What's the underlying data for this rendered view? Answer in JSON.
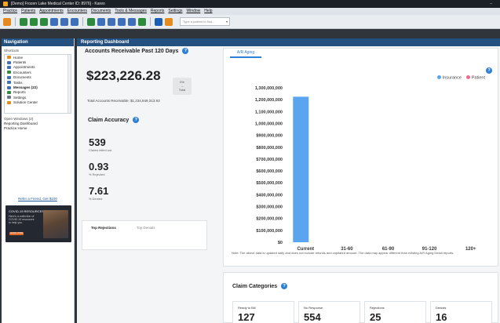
{
  "window": {
    "title": "[Demo] Frozen Lake Medical Center ID: 8976] - Kareo",
    "minimize": "–"
  },
  "menu": [
    "Practice",
    "Patients",
    "Appointments",
    "Encounters",
    "Documents",
    "Tools & Messages",
    "Reports",
    "Settings",
    "Window",
    "Help"
  ],
  "toolbar": {
    "icon_colors": [
      "#e58a1f",
      "#2e8b3e",
      "#2e8b3e",
      "#2e8b3e",
      "#3f6fb8",
      "#3f6fb8",
      "#3f6fb8",
      "#2e8b3e",
      "#3f6fb8",
      "#3f6fb8",
      "#3f6fb8",
      "#3f6fb8",
      "#2e8b3e",
      "#1a5fb4",
      "#e58a1f"
    ],
    "patient_search_placeholder": "Type a patient to find...",
    "dropdown_glyph": "▾"
  },
  "navigation": {
    "header": "Navigation",
    "shortcuts_label": "Shortcuts",
    "items": [
      {
        "label": "Home",
        "color": "#e58a1f",
        "active": false
      },
      {
        "label": "Patients",
        "color": "#3f6fb8",
        "active": false
      },
      {
        "label": "Appointments",
        "color": "#3f6fb8",
        "active": false
      },
      {
        "label": "Encounters",
        "color": "#2e8b3e",
        "active": false
      },
      {
        "label": "Documents",
        "color": "#3f6fb8",
        "active": false
      },
      {
        "label": "Tasks",
        "color": "#3f6fb8",
        "active": false
      },
      {
        "label": "Messages (22)",
        "color": "#3f6fb8",
        "active": true
      },
      {
        "label": "Reports",
        "color": "#2e8b3e",
        "active": false
      },
      {
        "label": "Settings",
        "color": "#6b7a8a",
        "active": false
      },
      {
        "label": "Solution Center",
        "color": "#e58a1f",
        "active": false
      }
    ],
    "open_windows_label": "Open Windows (2)",
    "open_windows": [
      "Reporting Dashboard",
      "Practice Home"
    ],
    "refer_link": "Refer a Friend, Get $100",
    "promo": {
      "title": "COVID-19 RESOURCES",
      "text": "Here's a collection of COVID-19 resources to help you.",
      "button": "LEARN MORE"
    }
  },
  "dashboard": {
    "header": "Reporting Dashboard",
    "ar": {
      "title": "Accounts Receivable Past 120 Days",
      "amount": "$223,226.28",
      "badge_pct": "0%",
      "badge_arrow": "→",
      "badge_label": "Total",
      "total_text": "Total Accounts Receivable: $1,234,849,313.93"
    },
    "accuracy": {
      "title": "Claim Accuracy",
      "stats": [
        {
          "value": "539",
          "label": "Claims billed out"
        },
        {
          "value": "0.93",
          "label": "% Rejected"
        },
        {
          "value": "7.61",
          "label": "% Denied"
        }
      ]
    },
    "rejections": {
      "tabs": [
        "Top Rejections",
        "Top Denials"
      ]
    },
    "aging": {
      "tab": "A/R Aging",
      "help_glyph": "?",
      "note": "Note: The above data is updated daily and does not include refunds and capitated amount. The data may appear different than existing A/R Aging Detail reports."
    },
    "categories": {
      "title": "Claim Categories",
      "boxes": [
        {
          "label": "Ready to Bill",
          "value": "127"
        },
        {
          "label": "No Response",
          "value": "554"
        },
        {
          "label": "Rejections",
          "value": "25"
        },
        {
          "label": "Denials",
          "value": "16"
        }
      ]
    }
  },
  "chart_data": {
    "type": "bar",
    "categories": [
      "Current",
      "31-60",
      "61-90",
      "91-120",
      "120+"
    ],
    "series": [
      {
        "name": "Insurance",
        "color": "#5ba4f0",
        "values": [
          1225000000,
          0,
          0,
          0,
          0
        ]
      },
      {
        "name": "Patient",
        "color": "#f06a8a",
        "values": [
          0,
          0,
          0,
          0,
          0
        ]
      }
    ],
    "xlabel": "Days",
    "ylim": [
      0,
      1300000000
    ],
    "yticks": [
      "$0",
      "$100,000,000",
      "$200,000,000",
      "$300,000,000",
      "$400,000,000",
      "$500,000,000",
      "$600,000,000",
      "$700,000,000",
      "$800,000,000",
      "$900,000,000",
      "1,000,000,000",
      "1,100,000,000",
      "1,200,000,000",
      "1,300,000,000"
    ],
    "legend_position": "top-right",
    "grid": false
  }
}
